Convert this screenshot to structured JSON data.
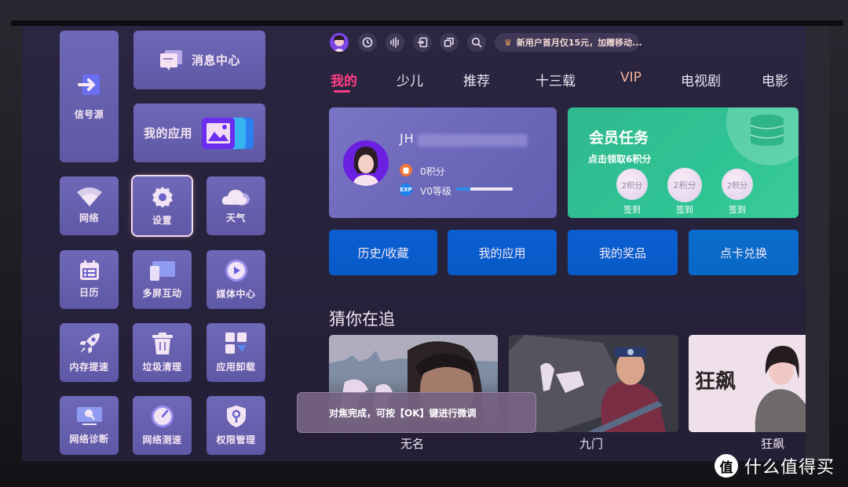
{
  "sidebar": {
    "signal_source": "信号源",
    "message_center": "消息中心",
    "my_apps": "我的应用",
    "grid": [
      {
        "label": "网络",
        "icon": "wifi-icon"
      },
      {
        "label": "设置",
        "icon": "gear-icon",
        "focused": true
      },
      {
        "label": "天气",
        "icon": "cloud-icon"
      },
      {
        "label": "日历",
        "icon": "calendar-icon"
      },
      {
        "label": "多屏互动",
        "icon": "multi-screen-icon"
      },
      {
        "label": "媒体中心",
        "icon": "play-icon"
      },
      {
        "label": "内存提速",
        "icon": "rocket-icon"
      },
      {
        "label": "垃圾清理",
        "icon": "trash-icon"
      },
      {
        "label": "应用卸载",
        "icon": "uninstall-icon"
      },
      {
        "label": "网络诊断",
        "icon": "network-diagnose-icon"
      },
      {
        "label": "网络测速",
        "icon": "speedometer-icon"
      },
      {
        "label": "权限管理",
        "icon": "shield-key-icon"
      }
    ]
  },
  "toolbar": {
    "icons": [
      "avatar",
      "clock-icon",
      "voice-icon",
      "input-icon",
      "window-icon",
      "search-icon"
    ],
    "promo": "新用户首月仅15元，加赠移动..."
  },
  "tabs": [
    {
      "label": "我的",
      "active": true
    },
    {
      "label": "少儿"
    },
    {
      "label": "推荐"
    },
    {
      "label": "十三载"
    },
    {
      "label": "VIP"
    },
    {
      "label": "电视剧"
    },
    {
      "label": "电影"
    }
  ],
  "profile": {
    "username_visible": "JH",
    "points": "0积分",
    "points_icon_label": "",
    "exp_icon_label": "EXP",
    "level": "V0等级",
    "level_progress": 0.25
  },
  "member_task": {
    "title": "会员任务",
    "subtitle": "点击领取6积分",
    "rewards": [
      {
        "value": "2积分",
        "action": "签到"
      },
      {
        "value": "2积分",
        "action": "签到"
      },
      {
        "value": "2积分",
        "action": "签到"
      }
    ]
  },
  "actions": [
    "历史/收藏",
    "我的应用",
    "我的奖品",
    "点卡兑换"
  ],
  "watching": {
    "title": "猜你在追",
    "items": [
      {
        "title": "无名"
      },
      {
        "title": "九门"
      },
      {
        "title": "狂飙"
      }
    ]
  },
  "toast": "对焦完成，可按【OK】键进行微调",
  "watermark": {
    "logo": "值",
    "text": "什么值得买"
  },
  "colors": {
    "accent": "#ff3e86",
    "tile": "#6a63b0",
    "action_blue": "#0b5ed0",
    "member_green": "#31b98f"
  }
}
